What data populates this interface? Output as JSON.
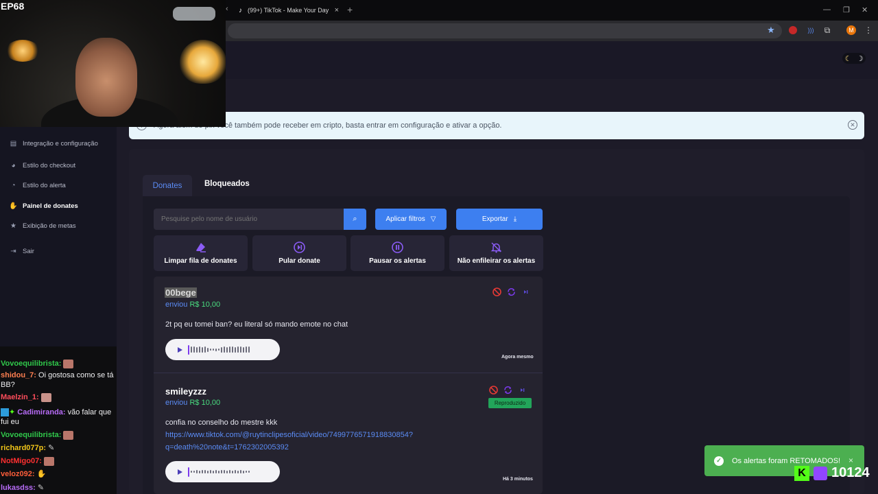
{
  "browser": {
    "tab_title": "(99+) TikTok - Make Your Day",
    "tab_close": "×",
    "new_tab": "+",
    "profile_initial": "M"
  },
  "stream": {
    "episode": "EP68",
    "sub_count": "10124"
  },
  "theme_toggle": {
    "moon": "☾",
    "sun": "☽"
  },
  "banner": {
    "text": "Agora além de pix você também pode receber em cripto, basta entrar em configuração e ativar a opção."
  },
  "sidebar": {
    "items": [
      {
        "label": "Integração e configuração",
        "icon": "doc-icon"
      },
      {
        "label": "Estilo do checkout",
        "icon": "palette-icon"
      },
      {
        "label": "Estilo do alerta",
        "icon": "palette-icon"
      },
      {
        "label": "Painel de donates",
        "icon": "hand-coin-icon"
      },
      {
        "label": "Exibição de metas",
        "icon": "star-icon"
      },
      {
        "label": "Sair",
        "icon": "logout-icon"
      }
    ]
  },
  "tabs": {
    "donates": "Donates",
    "blocked": "Bloqueados"
  },
  "toolbar": {
    "search_placeholder": "Pesquise pelo nome de usuário",
    "filters_label": "Aplicar filtros",
    "export_label": "Exportar"
  },
  "actions": [
    {
      "label": "Limpar fila de donates",
      "icon": "eraser-icon"
    },
    {
      "label": "Pular donate",
      "icon": "skip-icon"
    },
    {
      "label": "Pausar os alertas",
      "icon": "pause-icon"
    },
    {
      "label": "Não enfileirar os alertas",
      "icon": "bell-off-icon"
    }
  ],
  "donates": [
    {
      "name": "00bege",
      "sent": "enviou",
      "amount": "R$ 10,00",
      "message": "2t pq eu tomei ban? eu literal só mando emote no chat",
      "time": "Agora mesmo",
      "status": ""
    },
    {
      "name": "smileyzzz",
      "sent": "enviou",
      "amount": "R$ 10,00",
      "message": "confia no conselho do mestre kkk",
      "link_line1": "https://www.tiktok.com/@ruytinclipesoficial/video/7499776571918830854?",
      "link_line2": "q=death%20note&t=1762302005392",
      "time": "Há 3 minutos",
      "status": "Reproduzido"
    }
  ],
  "toast": {
    "text": "Os alertas foram RETOMADOS!",
    "close": "×"
  },
  "chat": [
    {
      "user": "Vovoequilibrista:",
      "color": "#30c94b",
      "text": ""
    },
    {
      "user": "shidou_7:",
      "color": "#ff7f50",
      "text": "Oi gostosa como se tá BB?"
    },
    {
      "user": "Maelzin_1:",
      "color": "#ff4d5b",
      "text": ""
    },
    {
      "user": "Cadimiranda:",
      "color": "#b86cf8",
      "text": "vão falar que fui eu"
    },
    {
      "user": "Vovoequilibrista:",
      "color": "#30c94b",
      "text": ""
    },
    {
      "user": "richard077p:",
      "color": "#f0c419",
      "text": ""
    },
    {
      "user": "NotMigo07:",
      "color": "#ff3030",
      "text": ""
    },
    {
      "user": "veloz092:",
      "color": "#ff5e3a",
      "text": ""
    },
    {
      "user": "lukasdss:",
      "color": "#b86cf8",
      "text": ""
    }
  ],
  "colors": {
    "accent": "#3d7ff0",
    "purple_icon": "#8b5cf6",
    "money": "#4ade80",
    "toast_bg": "#4caf50"
  }
}
